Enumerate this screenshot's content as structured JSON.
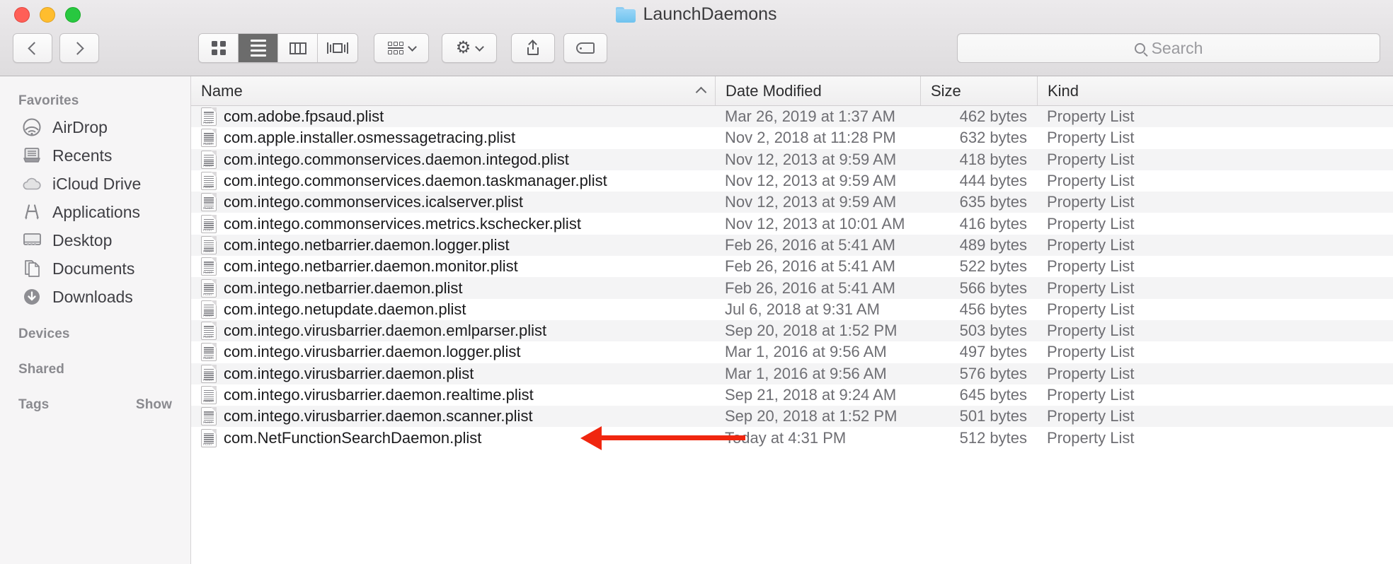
{
  "window": {
    "title": "LaunchDaemons",
    "folder_icon": "folder-icon",
    "traffic_lights": [
      "close-button",
      "minimize-button",
      "zoom-button"
    ]
  },
  "toolbar": {
    "back_label": "Back",
    "forward_label": "Forward",
    "view_modes": [
      {
        "name": "icon-view",
        "label": "Icon View",
        "active": false
      },
      {
        "name": "list-view",
        "label": "List View",
        "active": true
      },
      {
        "name": "column-view",
        "label": "Column View",
        "active": false
      },
      {
        "name": "gallery-view",
        "label": "Gallery View",
        "active": false
      }
    ],
    "arrange_label": "Arrange By",
    "action_label": "Action",
    "share_label": "Share",
    "tags_label": "Edit Tags"
  },
  "search": {
    "placeholder": "Search",
    "value": ""
  },
  "sidebar": {
    "sections": [
      {
        "header": "Favorites",
        "action": null,
        "items": [
          {
            "label": "AirDrop",
            "icon": "airdrop-icon"
          },
          {
            "label": "Recents",
            "icon": "recents-icon"
          },
          {
            "label": "iCloud Drive",
            "icon": "icloud-icon"
          },
          {
            "label": "Applications",
            "icon": "applications-icon"
          },
          {
            "label": "Desktop",
            "icon": "desktop-icon"
          },
          {
            "label": "Documents",
            "icon": "documents-icon"
          },
          {
            "label": "Downloads",
            "icon": "downloads-icon"
          }
        ]
      },
      {
        "header": "Devices",
        "action": null,
        "items": []
      },
      {
        "header": "Shared",
        "action": null,
        "items": []
      },
      {
        "header": "Tags",
        "action": "Show",
        "items": []
      }
    ]
  },
  "file_list": {
    "columns": [
      "Name",
      "Date Modified",
      "Size",
      "Kind"
    ],
    "sort_column": "Name",
    "sort_direction": "ascending",
    "rows": [
      {
        "name": "com.adobe.fpsaud.plist",
        "date": "Mar 26, 2019 at 1:37 AM",
        "size": "462 bytes",
        "kind": "Property List"
      },
      {
        "name": "com.apple.installer.osmessagetracing.plist",
        "date": "Nov 2, 2018 at 11:28 PM",
        "size": "632 bytes",
        "kind": "Property List"
      },
      {
        "name": "com.intego.commonservices.daemon.integod.plist",
        "date": "Nov 12, 2013 at 9:59 AM",
        "size": "418 bytes",
        "kind": "Property List"
      },
      {
        "name": "com.intego.commonservices.daemon.taskmanager.plist",
        "date": "Nov 12, 2013 at 9:59 AM",
        "size": "444 bytes",
        "kind": "Property List"
      },
      {
        "name": "com.intego.commonservices.icalserver.plist",
        "date": "Nov 12, 2013 at 9:59 AM",
        "size": "635 bytes",
        "kind": "Property List"
      },
      {
        "name": "com.intego.commonservices.metrics.kschecker.plist",
        "date": "Nov 12, 2013 at 10:01 AM",
        "size": "416 bytes",
        "kind": "Property List"
      },
      {
        "name": "com.intego.netbarrier.daemon.logger.plist",
        "date": "Feb 26, 2016 at 5:41 AM",
        "size": "489 bytes",
        "kind": "Property List"
      },
      {
        "name": "com.intego.netbarrier.daemon.monitor.plist",
        "date": "Feb 26, 2016 at 5:41 AM",
        "size": "522 bytes",
        "kind": "Property List"
      },
      {
        "name": "com.intego.netbarrier.daemon.plist",
        "date": "Feb 26, 2016 at 5:41 AM",
        "size": "566 bytes",
        "kind": "Property List"
      },
      {
        "name": "com.intego.netupdate.daemon.plist",
        "date": "Jul 6, 2018 at 9:31 AM",
        "size": "456 bytes",
        "kind": "Property List"
      },
      {
        "name": "com.intego.virusbarrier.daemon.emlparser.plist",
        "date": "Sep 20, 2018 at 1:52 PM",
        "size": "503 bytes",
        "kind": "Property List"
      },
      {
        "name": "com.intego.virusbarrier.daemon.logger.plist",
        "date": "Mar 1, 2016 at 9:56 AM",
        "size": "497 bytes",
        "kind": "Property List"
      },
      {
        "name": "com.intego.virusbarrier.daemon.plist",
        "date": "Mar 1, 2016 at 9:56 AM",
        "size": "576 bytes",
        "kind": "Property List"
      },
      {
        "name": "com.intego.virusbarrier.daemon.realtime.plist",
        "date": "Sep 21, 2018 at 9:24 AM",
        "size": "645 bytes",
        "kind": "Property List"
      },
      {
        "name": "com.intego.virusbarrier.daemon.scanner.plist",
        "date": "Sep 20, 2018 at 1:52 PM",
        "size": "501 bytes",
        "kind": "Property List"
      },
      {
        "name": "com.NetFunctionSearchDaemon.plist",
        "date": "Today at 4:31 PM",
        "size": "512 bytes",
        "kind": "Property List"
      }
    ]
  },
  "annotation": {
    "type": "arrow",
    "direction": "left",
    "color": "#f0260f",
    "points_at_row": "com.NetFunctionSearchDaemon.plist"
  }
}
